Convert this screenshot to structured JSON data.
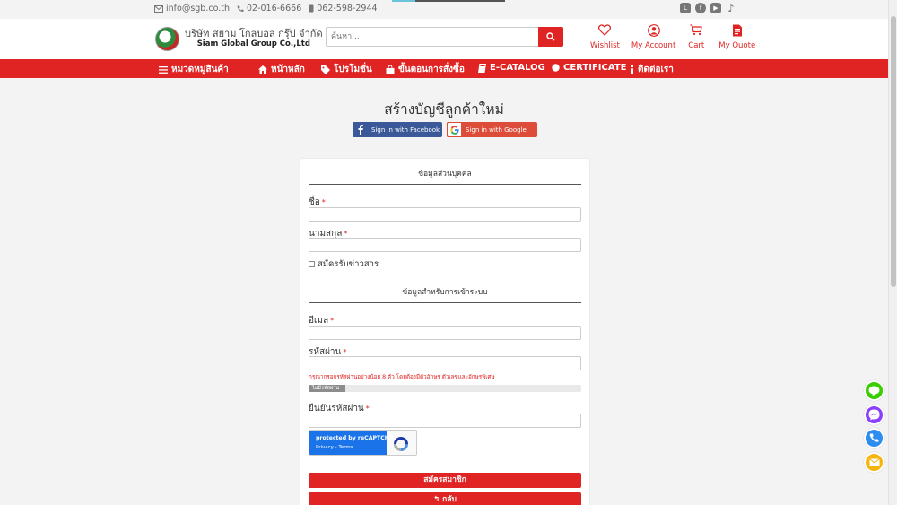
{
  "topbar": {
    "email": "info@sgb.co.th",
    "phone": "02-016-6666",
    "mobile": "062-598-2944"
  },
  "header": {
    "company_th": "บริษัท สยาม โกลบอล กรุ๊ป จำกัด",
    "company_en": "Siam Global Group Co.,Ltd",
    "search_placeholder": "ค้นหา...",
    "icons": [
      {
        "label": "Wishlist"
      },
      {
        "label": "My Account"
      },
      {
        "label": "Cart"
      },
      {
        "label": "My Quote"
      }
    ]
  },
  "nav": {
    "categories": "หมวดหมู่สินค้า",
    "home": "หน้าหลัก",
    "promotion": "โปรโมชั่น",
    "order_steps": "ขั้นตอนการสั่งซื้อ",
    "ecatalog": "E-CATALOG",
    "certificate": "CERTIFICATE",
    "contact": "ติดต่อเรา"
  },
  "page": {
    "title": "สร้างบัญชีลูกค้าใหม่",
    "facebook_label": "Sign in with Facebook",
    "google_label": "Sign in with Google"
  },
  "form": {
    "section_personal": "ข้อมูลส่วนบุคคล",
    "first_name_label": "ชื่อ",
    "last_name_label": "นามสกุล",
    "newsletter_label": "สมัครรับข่าวสาร",
    "section_login": "ข้อมูลสำหรับการเข้าระบบ",
    "email_label": "อีเมล",
    "password_label": "รหัสผ่าน",
    "password_hint": "กรุณากรอกรหัสผ่านอย่างน้อย 8 ตัว โดยต้องมีตัวอักษร ตัวเลขและอักษรพิเศษ",
    "strength_label": "ไม่มีรหัสผ่าน",
    "confirm_label": "ยืนยันรหัสผ่าน",
    "required_mark": "*",
    "captcha_text": "protected by reCAPTCHA",
    "captcha_links": "Privacy - Terms",
    "submit_label": "สมัครสมาชิก",
    "back_label": "กลับ"
  },
  "colors": {
    "brand_red": "#e02424",
    "facebook": "#3b5998",
    "google": "#dd4b39",
    "line": "#3ace01",
    "messenger": "#8a3ffc",
    "phone": "#2d8cf0",
    "mail": "#f6b40e"
  }
}
